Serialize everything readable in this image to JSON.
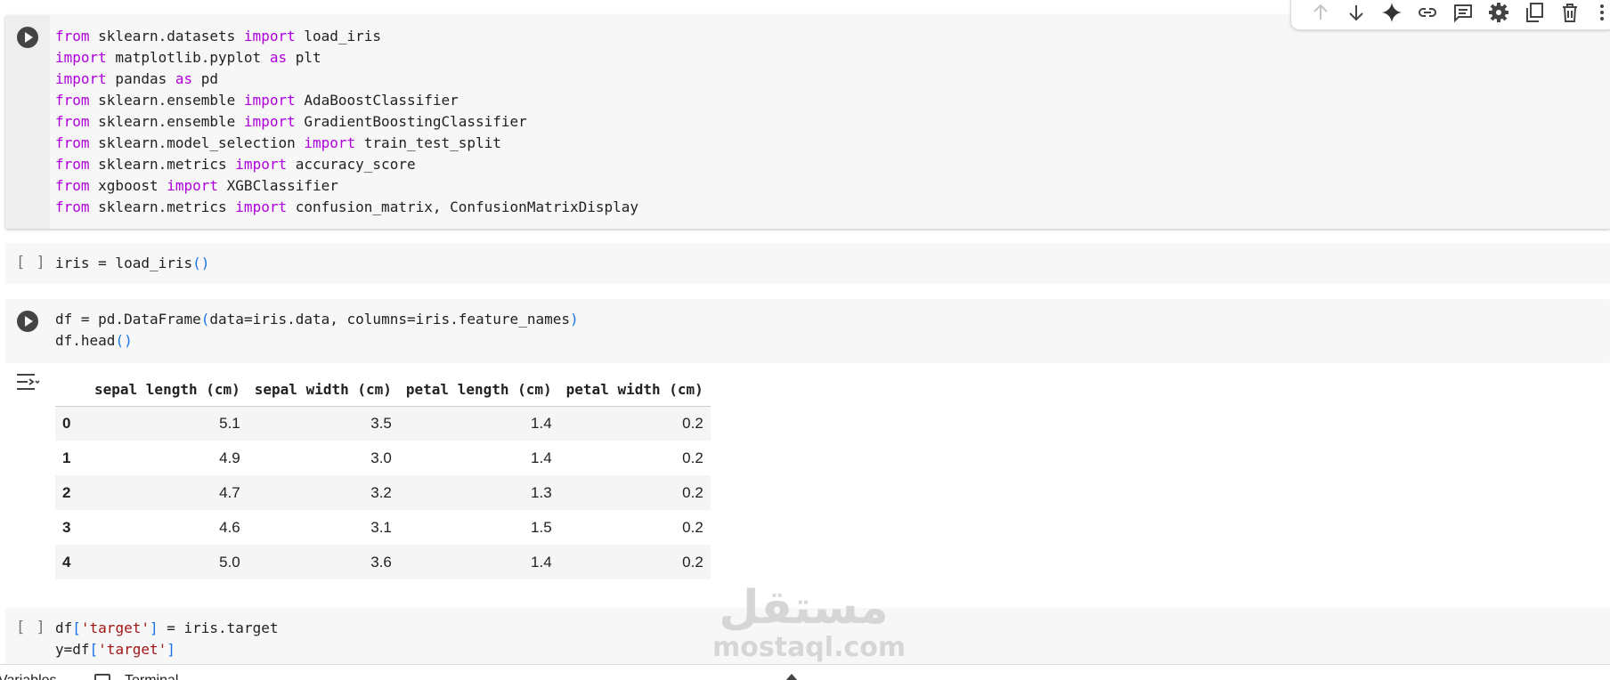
{
  "cell1": {
    "lines": [
      [
        {
          "t": "from",
          "c": "kw"
        },
        {
          "t": " sklearn.datasets "
        },
        {
          "t": "import",
          "c": "kw"
        },
        {
          "t": " load_iris"
        }
      ],
      [
        {
          "t": "import",
          "c": "kw"
        },
        {
          "t": " matplotlib.pyplot "
        },
        {
          "t": "as",
          "c": "kw"
        },
        {
          "t": " plt"
        }
      ],
      [
        {
          "t": "import",
          "c": "kw"
        },
        {
          "t": " pandas "
        },
        {
          "t": "as",
          "c": "kw"
        },
        {
          "t": " pd"
        }
      ],
      [
        {
          "t": "from",
          "c": "kw"
        },
        {
          "t": " sklearn.ensemble "
        },
        {
          "t": "import",
          "c": "kw"
        },
        {
          "t": " AdaBoostClassifier"
        }
      ],
      [
        {
          "t": "from",
          "c": "kw"
        },
        {
          "t": " sklearn.ensemble "
        },
        {
          "t": "import",
          "c": "kw"
        },
        {
          "t": " GradientBoostingClassifier"
        }
      ],
      [
        {
          "t": "from",
          "c": "kw"
        },
        {
          "t": " sklearn.model_selection "
        },
        {
          "t": "import",
          "c": "kw"
        },
        {
          "t": " train_test_split"
        }
      ],
      [
        {
          "t": "from",
          "c": "kw"
        },
        {
          "t": " sklearn.metrics "
        },
        {
          "t": "import",
          "c": "kw"
        },
        {
          "t": " accuracy_score"
        }
      ],
      [
        {
          "t": "from",
          "c": "kw"
        },
        {
          "t": " xgboost "
        },
        {
          "t": "import",
          "c": "kw"
        },
        {
          "t": " XGBClassifier"
        }
      ],
      [
        {
          "t": "from",
          "c": "kw"
        },
        {
          "t": " sklearn.metrics "
        },
        {
          "t": "import",
          "c": "kw"
        },
        {
          "t": " confusion_matrix, ConfusionMatrixDisplay"
        }
      ]
    ]
  },
  "cell2": {
    "bracket": "[ ]",
    "lines": [
      [
        {
          "t": "iris = load_iris"
        },
        {
          "t": "()",
          "c": "par"
        }
      ]
    ]
  },
  "cell3": {
    "lines": [
      [
        {
          "t": "df = pd.DataFrame"
        },
        {
          "t": "(",
          "c": "par"
        },
        {
          "t": "data=iris.data, columns=iris.feature_names"
        },
        {
          "t": ")",
          "c": "par"
        }
      ],
      [
        {
          "t": "df.head"
        },
        {
          "t": "()",
          "c": "par"
        }
      ]
    ]
  },
  "output_table": {
    "columns": [
      "",
      "sepal length (cm)",
      "sepal width (cm)",
      "petal length (cm)",
      "petal width (cm)"
    ],
    "rows": [
      [
        "0",
        "5.1",
        "3.5",
        "1.4",
        "0.2"
      ],
      [
        "1",
        "4.9",
        "3.0",
        "1.4",
        "0.2"
      ],
      [
        "2",
        "4.7",
        "3.2",
        "1.3",
        "0.2"
      ],
      [
        "3",
        "4.6",
        "3.1",
        "1.5",
        "0.2"
      ],
      [
        "4",
        "5.0",
        "3.6",
        "1.4",
        "0.2"
      ]
    ]
  },
  "cell4": {
    "bracket": "[ ]",
    "lines": [
      [
        {
          "t": "df"
        },
        {
          "t": "[",
          "c": "par"
        },
        {
          "t": "'target'",
          "c": "str"
        },
        {
          "t": "]",
          "c": "par"
        },
        {
          "t": " = iris.target"
        }
      ],
      [
        {
          "t": "y=df"
        },
        {
          "t": "[",
          "c": "par"
        },
        {
          "t": "'target'",
          "c": "str"
        },
        {
          "t": "]",
          "c": "par"
        }
      ]
    ]
  },
  "toolbar": {
    "icons": [
      "move-up-icon",
      "move-down-icon",
      "gemini-sparkle-icon",
      "link-icon",
      "comment-icon",
      "settings-gear-icon",
      "mirror-cell-icon",
      "delete-trash-icon",
      "more-vert-icon"
    ]
  },
  "watermark": {
    "logo": "مستقل",
    "text": "mostaql.com"
  },
  "statusbar": {
    "variables": "Variables",
    "terminal": "Terminal"
  },
  "colors": {
    "keyword": "#af00db",
    "paren": "#1a73e8",
    "string": "#a31515",
    "cell_bg": "#f7f7f7"
  }
}
